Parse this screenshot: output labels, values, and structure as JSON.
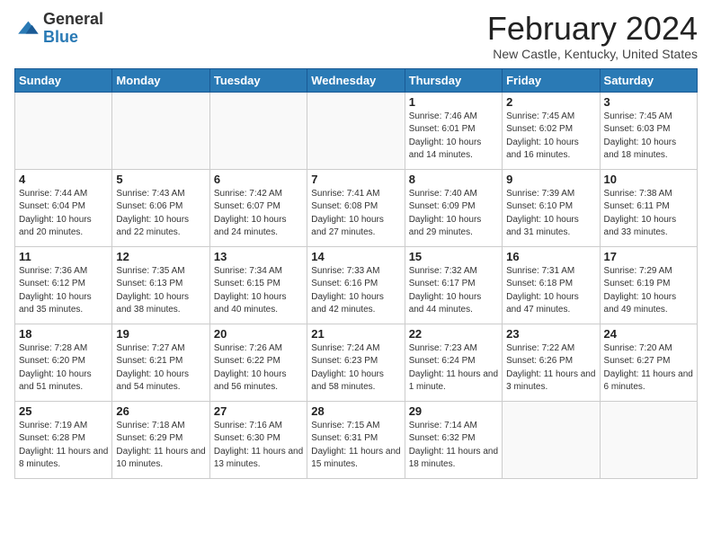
{
  "logo": {
    "general": "General",
    "blue": "Blue"
  },
  "title": "February 2024",
  "subtitle": "New Castle, Kentucky, United States",
  "weekdays": [
    "Sunday",
    "Monday",
    "Tuesday",
    "Wednesday",
    "Thursday",
    "Friday",
    "Saturday"
  ],
  "weeks": [
    [
      {
        "day": "",
        "sunrise": "",
        "sunset": "",
        "daylight": ""
      },
      {
        "day": "",
        "sunrise": "",
        "sunset": "",
        "daylight": ""
      },
      {
        "day": "",
        "sunrise": "",
        "sunset": "",
        "daylight": ""
      },
      {
        "day": "",
        "sunrise": "",
        "sunset": "",
        "daylight": ""
      },
      {
        "day": "1",
        "sunrise": "Sunrise: 7:46 AM",
        "sunset": "Sunset: 6:01 PM",
        "daylight": "Daylight: 10 hours and 14 minutes."
      },
      {
        "day": "2",
        "sunrise": "Sunrise: 7:45 AM",
        "sunset": "Sunset: 6:02 PM",
        "daylight": "Daylight: 10 hours and 16 minutes."
      },
      {
        "day": "3",
        "sunrise": "Sunrise: 7:45 AM",
        "sunset": "Sunset: 6:03 PM",
        "daylight": "Daylight: 10 hours and 18 minutes."
      }
    ],
    [
      {
        "day": "4",
        "sunrise": "Sunrise: 7:44 AM",
        "sunset": "Sunset: 6:04 PM",
        "daylight": "Daylight: 10 hours and 20 minutes."
      },
      {
        "day": "5",
        "sunrise": "Sunrise: 7:43 AM",
        "sunset": "Sunset: 6:06 PM",
        "daylight": "Daylight: 10 hours and 22 minutes."
      },
      {
        "day": "6",
        "sunrise": "Sunrise: 7:42 AM",
        "sunset": "Sunset: 6:07 PM",
        "daylight": "Daylight: 10 hours and 24 minutes."
      },
      {
        "day": "7",
        "sunrise": "Sunrise: 7:41 AM",
        "sunset": "Sunset: 6:08 PM",
        "daylight": "Daylight: 10 hours and 27 minutes."
      },
      {
        "day": "8",
        "sunrise": "Sunrise: 7:40 AM",
        "sunset": "Sunset: 6:09 PM",
        "daylight": "Daylight: 10 hours and 29 minutes."
      },
      {
        "day": "9",
        "sunrise": "Sunrise: 7:39 AM",
        "sunset": "Sunset: 6:10 PM",
        "daylight": "Daylight: 10 hours and 31 minutes."
      },
      {
        "day": "10",
        "sunrise": "Sunrise: 7:38 AM",
        "sunset": "Sunset: 6:11 PM",
        "daylight": "Daylight: 10 hours and 33 minutes."
      }
    ],
    [
      {
        "day": "11",
        "sunrise": "Sunrise: 7:36 AM",
        "sunset": "Sunset: 6:12 PM",
        "daylight": "Daylight: 10 hours and 35 minutes."
      },
      {
        "day": "12",
        "sunrise": "Sunrise: 7:35 AM",
        "sunset": "Sunset: 6:13 PM",
        "daylight": "Daylight: 10 hours and 38 minutes."
      },
      {
        "day": "13",
        "sunrise": "Sunrise: 7:34 AM",
        "sunset": "Sunset: 6:15 PM",
        "daylight": "Daylight: 10 hours and 40 minutes."
      },
      {
        "day": "14",
        "sunrise": "Sunrise: 7:33 AM",
        "sunset": "Sunset: 6:16 PM",
        "daylight": "Daylight: 10 hours and 42 minutes."
      },
      {
        "day": "15",
        "sunrise": "Sunrise: 7:32 AM",
        "sunset": "Sunset: 6:17 PM",
        "daylight": "Daylight: 10 hours and 44 minutes."
      },
      {
        "day": "16",
        "sunrise": "Sunrise: 7:31 AM",
        "sunset": "Sunset: 6:18 PM",
        "daylight": "Daylight: 10 hours and 47 minutes."
      },
      {
        "day": "17",
        "sunrise": "Sunrise: 7:29 AM",
        "sunset": "Sunset: 6:19 PM",
        "daylight": "Daylight: 10 hours and 49 minutes."
      }
    ],
    [
      {
        "day": "18",
        "sunrise": "Sunrise: 7:28 AM",
        "sunset": "Sunset: 6:20 PM",
        "daylight": "Daylight: 10 hours and 51 minutes."
      },
      {
        "day": "19",
        "sunrise": "Sunrise: 7:27 AM",
        "sunset": "Sunset: 6:21 PM",
        "daylight": "Daylight: 10 hours and 54 minutes."
      },
      {
        "day": "20",
        "sunrise": "Sunrise: 7:26 AM",
        "sunset": "Sunset: 6:22 PM",
        "daylight": "Daylight: 10 hours and 56 minutes."
      },
      {
        "day": "21",
        "sunrise": "Sunrise: 7:24 AM",
        "sunset": "Sunset: 6:23 PM",
        "daylight": "Daylight: 10 hours and 58 minutes."
      },
      {
        "day": "22",
        "sunrise": "Sunrise: 7:23 AM",
        "sunset": "Sunset: 6:24 PM",
        "daylight": "Daylight: 11 hours and 1 minute."
      },
      {
        "day": "23",
        "sunrise": "Sunrise: 7:22 AM",
        "sunset": "Sunset: 6:26 PM",
        "daylight": "Daylight: 11 hours and 3 minutes."
      },
      {
        "day": "24",
        "sunrise": "Sunrise: 7:20 AM",
        "sunset": "Sunset: 6:27 PM",
        "daylight": "Daylight: 11 hours and 6 minutes."
      }
    ],
    [
      {
        "day": "25",
        "sunrise": "Sunrise: 7:19 AM",
        "sunset": "Sunset: 6:28 PM",
        "daylight": "Daylight: 11 hours and 8 minutes."
      },
      {
        "day": "26",
        "sunrise": "Sunrise: 7:18 AM",
        "sunset": "Sunset: 6:29 PM",
        "daylight": "Daylight: 11 hours and 10 minutes."
      },
      {
        "day": "27",
        "sunrise": "Sunrise: 7:16 AM",
        "sunset": "Sunset: 6:30 PM",
        "daylight": "Daylight: 11 hours and 13 minutes."
      },
      {
        "day": "28",
        "sunrise": "Sunrise: 7:15 AM",
        "sunset": "Sunset: 6:31 PM",
        "daylight": "Daylight: 11 hours and 15 minutes."
      },
      {
        "day": "29",
        "sunrise": "Sunrise: 7:14 AM",
        "sunset": "Sunset: 6:32 PM",
        "daylight": "Daylight: 11 hours and 18 minutes."
      },
      {
        "day": "",
        "sunrise": "",
        "sunset": "",
        "daylight": ""
      },
      {
        "day": "",
        "sunrise": "",
        "sunset": "",
        "daylight": ""
      }
    ]
  ]
}
